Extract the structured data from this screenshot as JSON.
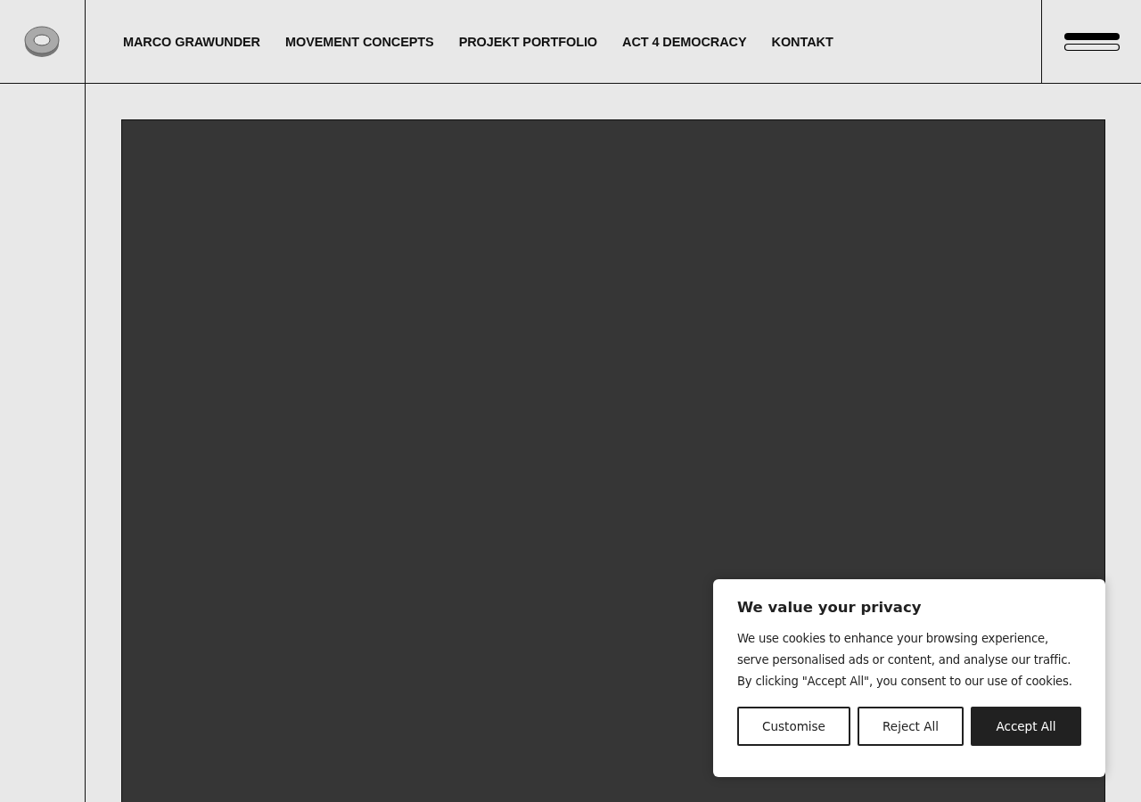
{
  "nav": {
    "items": [
      {
        "label": "MARCO GRAWUNDER"
      },
      {
        "label": "MOVEMENT CONCEPTS"
      },
      {
        "label": "PROJEKT PORTFOLIO"
      },
      {
        "label": "ACT 4 DEMOCRACY"
      },
      {
        "label": "KONTAKT"
      }
    ]
  },
  "cookie_banner": {
    "title": "We value your privacy",
    "text": "We use cookies to enhance your browsing experience, serve personalised ads or content, and analyse our traffic. By clicking \"Accept All\", you consent to our use of cookies.",
    "buttons": [
      {
        "label": "Customise",
        "kind": "outline"
      },
      {
        "label": "Reject All",
        "kind": "outline"
      },
      {
        "label": "Accept All",
        "kind": "filled"
      }
    ]
  }
}
